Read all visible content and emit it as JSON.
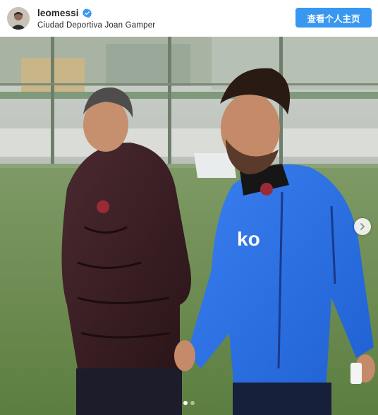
{
  "post": {
    "username": "leomessi",
    "location": "Ciudad Deportiva Joan Gamper",
    "verified": true,
    "profile_button_label": "查看个人主页"
  },
  "photo": {
    "jersey_sponsor_text": "ko",
    "carousel": {
      "total_slides": 2,
      "active_slide": 1
    }
  },
  "icons": {
    "verified": "verified-badge-icon",
    "next": "chevron-right-icon"
  },
  "colors": {
    "button_bg": "#3897f0",
    "verified_badge": "#3897f0",
    "text": "#262626"
  }
}
